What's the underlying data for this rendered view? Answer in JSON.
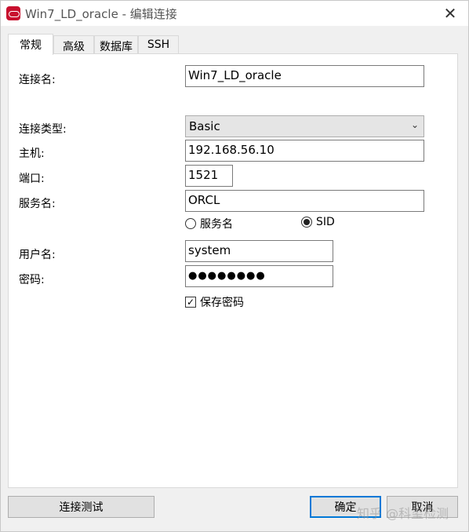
{
  "window": {
    "title": "Win7_LD_oracle - 编辑连接",
    "close_glyph": "✕"
  },
  "tabs": [
    {
      "label": "常规",
      "active": true
    },
    {
      "label": "高级",
      "active": false
    },
    {
      "label": "数据库",
      "active": false
    },
    {
      "label": "SSH",
      "active": false
    }
  ],
  "form": {
    "conn_name_label": "连接名:",
    "conn_name_value": "Win7_LD_oracle",
    "conn_type_label": "连接类型:",
    "conn_type_value": "Basic",
    "host_label": "主机:",
    "host_value": "192.168.56.10",
    "port_label": "端口:",
    "port_value": "1521",
    "service_label": "服务名:",
    "service_value": "ORCL",
    "radio_service_label": "服务名",
    "radio_sid_label": "SID",
    "selected_radio": "SID",
    "user_label": "用户名:",
    "user_value": "system",
    "password_label": "密码:",
    "password_masked": "●●●●●●●●",
    "save_password_label": "保存密码",
    "save_password_checked": true
  },
  "buttons": {
    "test_label": "连接测试",
    "ok_label": "确定",
    "cancel_label": "取消"
  },
  "watermark": "知乎 @科玺检测",
  "colors": {
    "accent": "#0078d7",
    "app_icon": "#c8102e",
    "window_bg": "#f0f0f0"
  }
}
